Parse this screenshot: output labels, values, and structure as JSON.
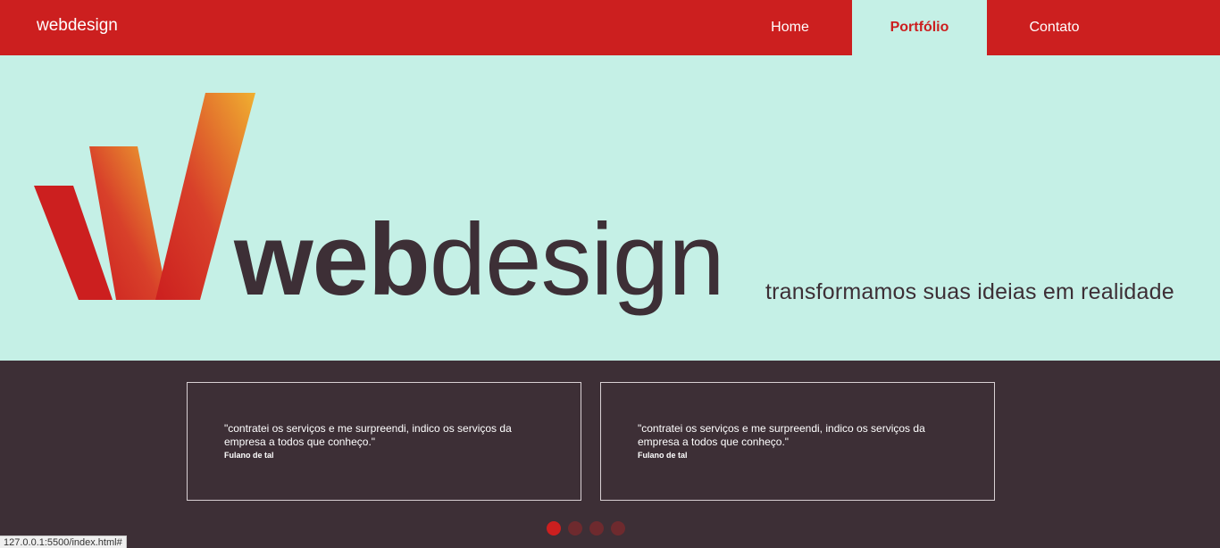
{
  "header": {
    "brand": "webdesign",
    "nav": [
      {
        "label": "Home",
        "active": false
      },
      {
        "label": "Portfólio",
        "active": true
      },
      {
        "label": "Contato",
        "active": false
      }
    ]
  },
  "hero": {
    "logo_bold": "web",
    "logo_light": "design",
    "tagline": "transformamos suas ideias em realidade"
  },
  "testimonials": [
    {
      "quote": "\"contratei os serviços e me surpreendi, indico os serviços da empresa a todos que conheço.\"",
      "author": "Fulano de tal"
    },
    {
      "quote": "\"contratei os serviços e me surpreendi, indico os serviços da empresa a todos que conheço.\"",
      "author": "Fulano de tal"
    }
  ],
  "carousel": {
    "count": 4,
    "active_index": 0
  },
  "statusbar": {
    "url": "127.0.0.1:5500/index.html#"
  },
  "colors": {
    "primary": "#cc1f1f",
    "hero_bg": "#c5f0e6",
    "dark": "#3d2f36",
    "logo_gradient_end": "#f0b030"
  }
}
